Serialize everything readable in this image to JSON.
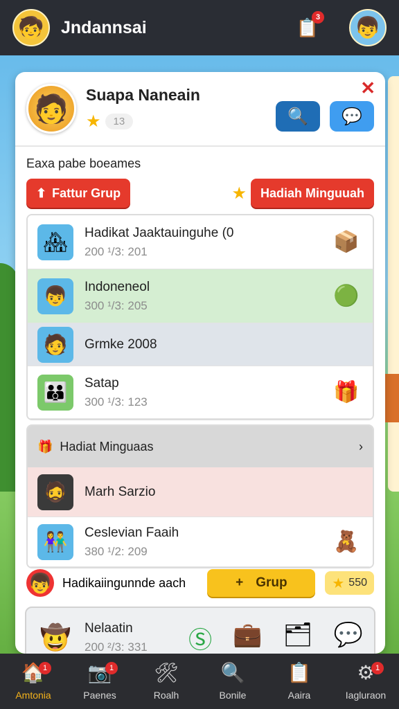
{
  "topbar": {
    "title": "Jndannsai",
    "clip_badge": "3"
  },
  "profile": {
    "name": "Suapa Naneain",
    "level": "13"
  },
  "section_label": "Eaxa pabe boeames",
  "tabs": {
    "left": "Fattur Grup",
    "right": "Hadiah Minguuah"
  },
  "list1": [
    {
      "title": "Hadikat Jaaktauinguhe (0",
      "sub": "200 ¹/3: 201",
      "thumb_icon": "building-icon",
      "side_icon": "package-icon",
      "bg": "#ffffff"
    },
    {
      "title": "Indoneneol",
      "sub": "300 ¹/3: 205",
      "thumb_icon": "boy-avatar-icon",
      "side_icon": "green-badge-icon",
      "bg": "#d5eed2"
    },
    {
      "title": "Grmke 2008",
      "sub": "",
      "thumb_icon": "face-avatar-icon",
      "side_icon": "",
      "bg": "#dfe4ea"
    },
    {
      "title": "Satap",
      "sub": "300 ¹/3: 123",
      "thumb_icon": "people-icon",
      "side_icon": "gift-icon",
      "bg": "#ffffff"
    }
  ],
  "group_header": "Hadiat Minguaas",
  "list2": [
    {
      "title": "Marh Sarzio",
      "sub": "",
      "thumb_icon": "dark-avatar-icon",
      "side_icon": "",
      "bg": "#f8e1df"
    },
    {
      "title": "Ceslevian Faaih",
      "sub": "380 ¹/2: 209",
      "thumb_icon": "couple-icon",
      "side_icon": "teddy-bear-icon",
      "bg": "#ffffff"
    }
  ],
  "bottom": {
    "text": "Hadikaiingunnde aach",
    "grup_btn": "Grup",
    "score": "550"
  },
  "last_card": {
    "title": "Nelaatin",
    "sub": "200 ²/3: 331"
  },
  "nav": [
    {
      "label": "Amtonia",
      "icon": "home-icon",
      "badge": "1",
      "active": true
    },
    {
      "label": "Paenes",
      "icon": "camera-icon",
      "badge": "1",
      "active": false
    },
    {
      "label": "Roalh",
      "icon": "tools-icon",
      "badge": "",
      "active": false
    },
    {
      "label": "Bonile",
      "icon": "search-icon",
      "badge": "",
      "active": false
    },
    {
      "label": "Aaira",
      "icon": "clipboard-icon",
      "badge": "",
      "active": false
    },
    {
      "label": "Iagluraon",
      "icon": "settings-icon",
      "badge": "1",
      "active": false
    }
  ]
}
